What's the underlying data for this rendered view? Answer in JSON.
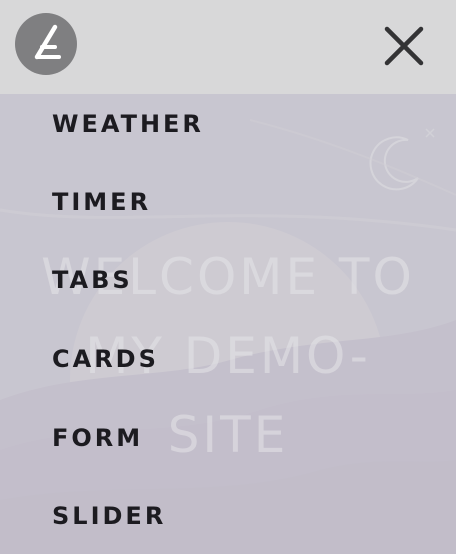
{
  "hero": {
    "lines": [
      "WELCOME TO",
      "MY DEMO-",
      "SITE"
    ]
  },
  "logo": {
    "icon": "logo-icon"
  },
  "close_button": {
    "icon": "close-icon"
  },
  "menu": {
    "items": [
      {
        "label": "WEATHER"
      },
      {
        "label": "TIMER"
      },
      {
        "label": "TABS"
      },
      {
        "label": "CARDS"
      },
      {
        "label": "FORM"
      },
      {
        "label": "SLIDER"
      }
    ]
  },
  "colors": {
    "topbar": "#d8d8d9",
    "logo_circle": "#7f7f81",
    "menu_text": "#1c1b20",
    "hero_text": "#ffffff"
  }
}
